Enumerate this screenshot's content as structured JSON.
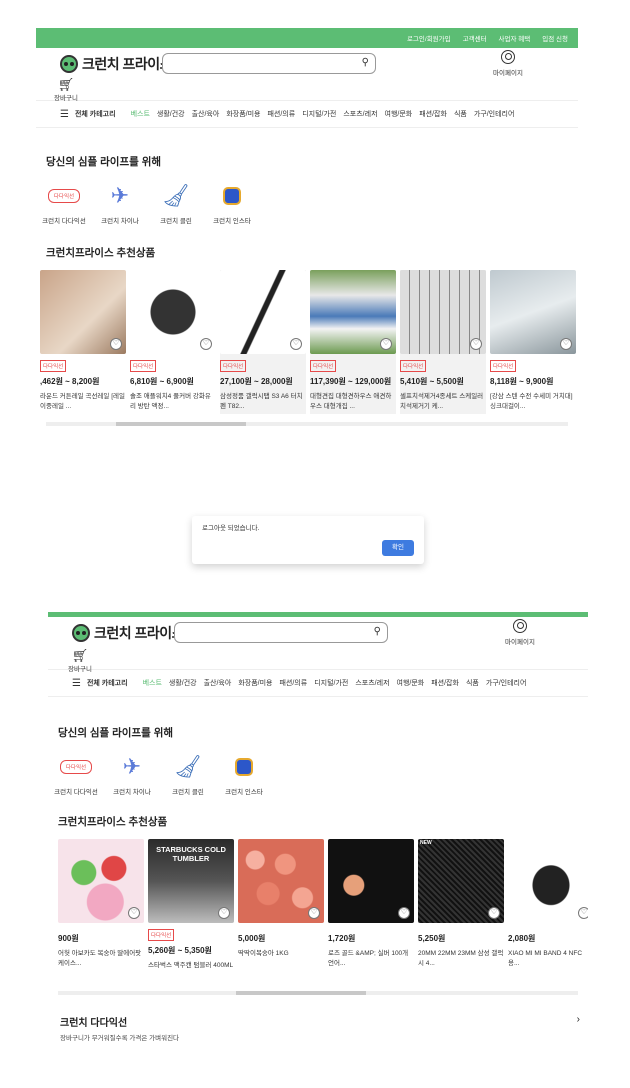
{
  "header": {
    "top_links": [
      "로그인/회원가입",
      "고객센터",
      "사업자 혜택",
      "입점 신청"
    ],
    "logo_text": "크런치 프라이스",
    "mypage_label": "마이페이지",
    "cart_label": "장바구니"
  },
  "nav": {
    "all_categories": "전체 카테고리",
    "categories": [
      "베스트",
      "생활/건강",
      "출산/육아",
      "화장품/미용",
      "패션/의류",
      "디지털/가전",
      "스포츠/레저",
      "여행/문화",
      "패션/잡화",
      "식품",
      "가구/인테리어"
    ]
  },
  "section1": {
    "title": "당신의 심플 라이프를 위해",
    "quick_links": [
      {
        "label": "크런치 다다익선",
        "pill": "다다익선"
      },
      {
        "label": "크런치 차이나"
      },
      {
        "label": "크런치 클린"
      },
      {
        "label": "크런치 인스타"
      }
    ]
  },
  "section2": {
    "title": "크런치프라이스 추천상품"
  },
  "products_before": [
    {
      "tag": "다다익선",
      "price": ",462원 ~ 8,200원",
      "name": "라운드 커튼레일 곡선레일 [레일 이중레일 ..."
    },
    {
      "tag": "다다익선",
      "price": "6,810원 ~ 6,900원",
      "name": "솔조 애플워치4 풀커버 강화유리 방탄 액정..."
    },
    {
      "tag": "다다익선",
      "price": "27,100원 ~ 28,000원",
      "name": "삼성정품 갤럭시탭 S3 A6 터치펜 T82..."
    },
    {
      "tag": "다다익선",
      "price": "117,390원 ~ 129,000원",
      "name": "대형견집 대형견하우스 애견하우스 대형개집 ..."
    },
    {
      "tag": "다다익선",
      "price": "5,410원 ~ 5,500원",
      "name": "셀프치석제거4종세트 스케일러 치석제거기 케..."
    },
    {
      "tag": "다다익선",
      "price": "8,118원 ~ 9,900원",
      "name": "[강삼 스텐 수전 수세미 거치대]싱크대걸이..."
    }
  ],
  "dialog": {
    "message": "로그아웃 되었습니다.",
    "ok_label": "확인"
  },
  "products_after": [
    {
      "price": "900원",
      "name": "어헛 아보카도 복숭아 딸에어팟 케이스..."
    },
    {
      "tag": "다다익선",
      "price": "5,260원 ~ 5,350원",
      "name": "스타벅스 맥주캔 텀블러 400ML",
      "img_text": "STARBUCKS COLD TUMBLER"
    },
    {
      "price": "5,000원",
      "name": "딱딱이복숭아 1KG"
    },
    {
      "price": "1,720원",
      "name": "로즈 골드 &AMP; 실버 100개 언어..."
    },
    {
      "price": "5,250원",
      "name": "20MM 22MM 23MM 삼성 갤럭시 4...",
      "img_text": "NEW"
    },
    {
      "price": "2,080원",
      "name": "XIAO MI MI BAND 4 NFC 용..."
    }
  ],
  "bottom": {
    "title": "크런치 다다익선",
    "subtitle": "장바구니가 무거워질수록 가격은 가벼워진다"
  },
  "colors": {
    "brand_green": "#5cbd74",
    "tag_red": "#e64a4a",
    "button_blue": "#3e7be0"
  }
}
